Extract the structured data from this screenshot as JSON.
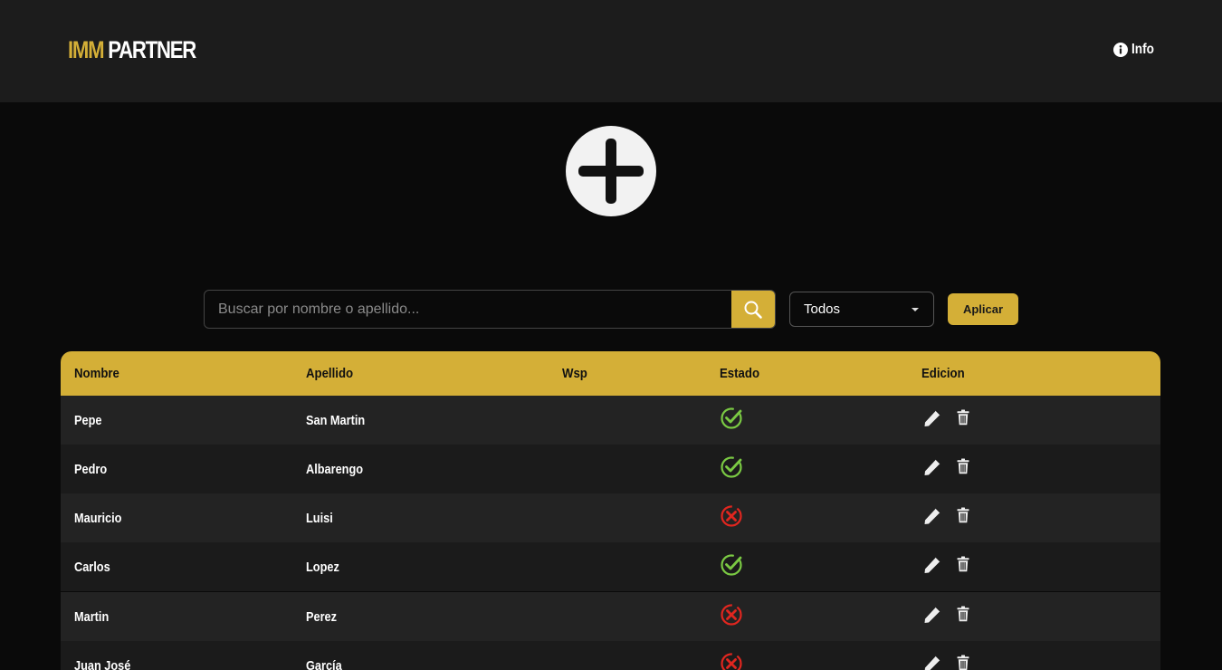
{
  "header": {
    "logo_part1": "IMM",
    "logo_part2": "PARTNER",
    "info_label": "Info"
  },
  "actions": {
    "add_icon": "plus-circle-icon"
  },
  "filters": {
    "search_placeholder": "Buscar por nombre o apellido...",
    "search_value": "",
    "status_selected": "Todos",
    "apply_label": "Aplicar"
  },
  "table": {
    "columns": [
      "Nombre",
      "Apellido",
      "Wsp",
      "Estado",
      "Edicion"
    ],
    "rows": [
      {
        "nombre": "Pepe",
        "apellido": "San Martin",
        "wsp": "",
        "estado": "activo"
      },
      {
        "nombre": "Pedro",
        "apellido": "Albarengo",
        "wsp": "",
        "estado": "activo"
      },
      {
        "nombre": "Mauricio",
        "apellido": "Luisi",
        "wsp": "",
        "estado": "inactivo"
      },
      {
        "nombre": "Carlos",
        "apellido": "Lopez",
        "wsp": "",
        "estado": "activo"
      },
      {
        "nombre": "Martin",
        "apellido": "Perez",
        "wsp": "",
        "estado": "inactivo"
      },
      {
        "nombre": "Juan José",
        "apellido": "García",
        "wsp": "",
        "estado": "inactivo"
      }
    ]
  },
  "colors": {
    "accent": "#d4af37",
    "active": "#7ac943",
    "inactive": "#e0261f",
    "background": "#0a0a0a",
    "topbar": "#1c1c1c"
  }
}
